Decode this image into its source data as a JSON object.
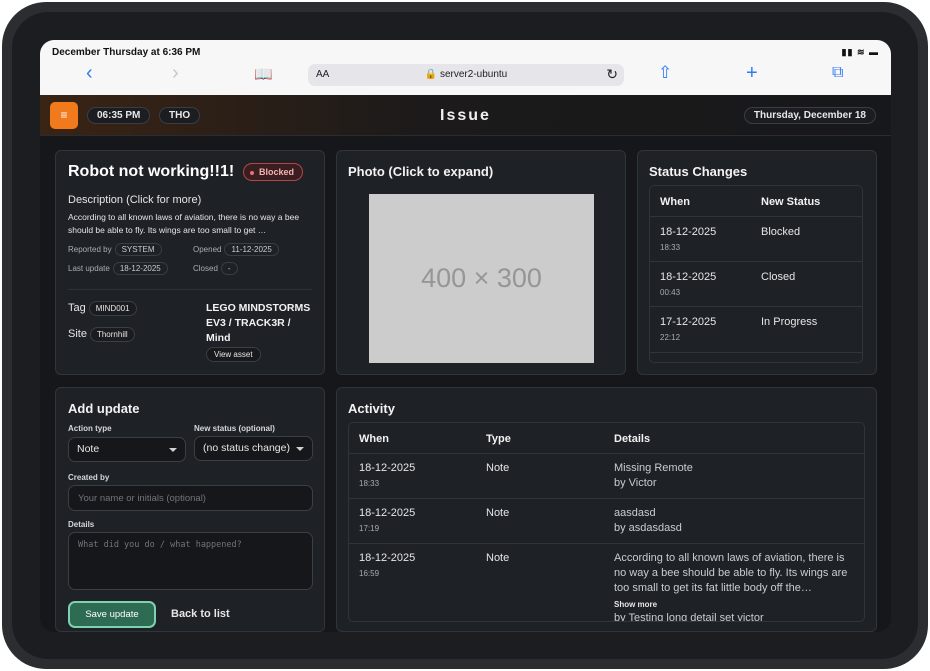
{
  "statusbar": {
    "datetime": "December Thursday at 6:36 PM",
    "indicators": "▮▮ ≋ ▬"
  },
  "browser": {
    "back": "‹",
    "forward": "›",
    "bookmarks": "📖",
    "aa": "AA",
    "url": "🔒 server2-ubuntu",
    "reload": "↻",
    "share": "⇧",
    "new_tab": "+",
    "tabs": "⧉"
  },
  "appbar": {
    "menu": "≡",
    "time": "06:35 PM",
    "day": "THO",
    "title": "Issue",
    "date": "Thursday, December 18"
  },
  "issue": {
    "title": "Robot not working!!1!",
    "status": "Blocked",
    "description_heading": "Description (Click for more)",
    "description": "According to all known laws of aviation, there is no way a bee should be able to fly. Its wings are too small to get …",
    "reported_by_label": "Reported by",
    "reported_by": "SYSTEM",
    "opened_label": "Opened",
    "opened": "11-12-2025",
    "last_update_label": "Last update",
    "last_update": "18-12-2025",
    "closed_label": "Closed",
    "closed": "-",
    "tag_label": "Tag",
    "tag": "MIND001",
    "site_label": "Site",
    "site": "Thornhill",
    "asset": "LEGO MINDSTORMS EV3 / TRACK3R / Mind",
    "view_asset": "View asset"
  },
  "photo": {
    "title": "Photo (Click to expand)",
    "placeholder": "400 × 300"
  },
  "status_changes": {
    "title": "Status Changes",
    "headers": [
      "When",
      "New Status"
    ],
    "rows": [
      {
        "date": "18-12-2025",
        "time": "18:33",
        "status": "Blocked"
      },
      {
        "date": "18-12-2025",
        "time": "00:43",
        "status": "Closed"
      },
      {
        "date": "17-12-2025",
        "time": "22:12",
        "status": "In Progress"
      }
    ]
  },
  "add_update": {
    "title": "Add update",
    "action_type_label": "Action type",
    "action_type": "Note",
    "new_status_label": "New status (optional)",
    "new_status": "(no status change)",
    "created_by_label": "Created by",
    "created_by_placeholder": "Your name or initials (optional)",
    "details_label": "Details",
    "details_placeholder": "What did you do / what happened?",
    "save": "Save update",
    "back": "Back to list"
  },
  "activity": {
    "title": "Activity",
    "headers": [
      "When",
      "Type",
      "Details"
    ],
    "rows": [
      {
        "date": "18-12-2025",
        "time": "18:33",
        "type": "Note",
        "details": "Missing Remote",
        "by": "by Victor"
      },
      {
        "date": "18-12-2025",
        "time": "17:19",
        "type": "Note",
        "details": "aasdasd",
        "by": "by asdasdasd"
      },
      {
        "date": "18-12-2025",
        "time": "16:59",
        "type": "Note",
        "details": "According to all known laws of aviation, there is no way a bee should be able to fly. Its wings are too small to get its fat little body off the…",
        "show_more": "Show more",
        "by": "by Testing long detail set victor"
      }
    ]
  }
}
